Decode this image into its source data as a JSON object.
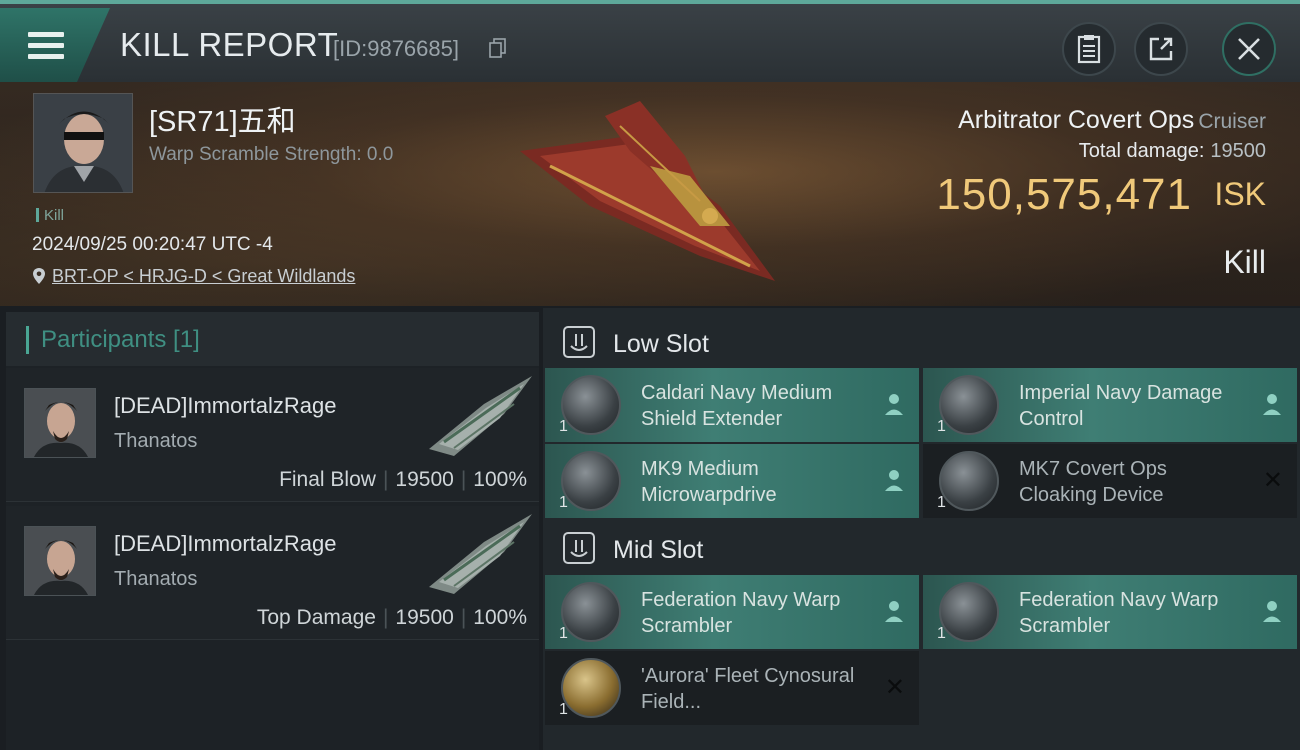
{
  "header": {
    "title": "KILL REPORT",
    "report_id": "[ID:9876685]"
  },
  "victim": {
    "name": "[SR71]五和",
    "warp_scramble": "Warp Scramble Strength: 0.0",
    "tag": "Kill",
    "timestamp": "2024/09/25 00:20:47 UTC -4",
    "location": "BRT-OP < HRJG-D < Great Wildlands"
  },
  "ship": {
    "name": "Arbitrator Covert Ops",
    "class": "Cruiser",
    "total_damage_label": "Total damage:",
    "total_damage": "19500",
    "isk_value": "150,575,471",
    "isk_unit": "ISK",
    "status": "Kill"
  },
  "participants": {
    "title": "Participants [1]",
    "items": [
      {
        "name": "[DEAD]ImmortalzRage",
        "ship": "Thanatos",
        "role": "Final Blow",
        "damage": "19500",
        "percent": "100%"
      },
      {
        "name": "[DEAD]ImmortalzRage",
        "ship": "Thanatos",
        "role": "Top Damage",
        "damage": "19500",
        "percent": "100%"
      }
    ]
  },
  "fitting": {
    "low_slot": {
      "title": "Low Slot",
      "modules": [
        {
          "name": "Caldari Navy Medium Shield Extender",
          "qty": "1",
          "state": "fitted",
          "icon": "shield-extender-icon"
        },
        {
          "name": "Imperial Navy Damage Control",
          "qty": "1",
          "state": "fitted",
          "icon": "damage-control-icon"
        },
        {
          "name": "MK9 Medium Microwarpdrive",
          "qty": "1",
          "state": "fitted",
          "icon": "microwarpdrive-icon"
        },
        {
          "name": "MK7 Covert Ops Cloaking Device",
          "qty": "1",
          "state": "destroyed",
          "icon": "cloaking-device-icon"
        }
      ]
    },
    "mid_slot": {
      "title": "Mid Slot",
      "modules": [
        {
          "name": "Federation Navy Warp Scrambler",
          "qty": "1",
          "state": "fitted",
          "icon": "warp-scrambler-icon"
        },
        {
          "name": "Federation Navy Warp Scrambler",
          "qty": "1",
          "state": "fitted",
          "icon": "warp-scrambler-icon"
        },
        {
          "name": "'Aurora' Fleet Cynosural Field...",
          "qty": "1",
          "state": "destroyed",
          "icon": "cyno-field-icon"
        }
      ]
    }
  },
  "colors": {
    "accent": "#5ea89a",
    "isk": "#f0c97a",
    "fitted_module": "#3f7e74"
  }
}
